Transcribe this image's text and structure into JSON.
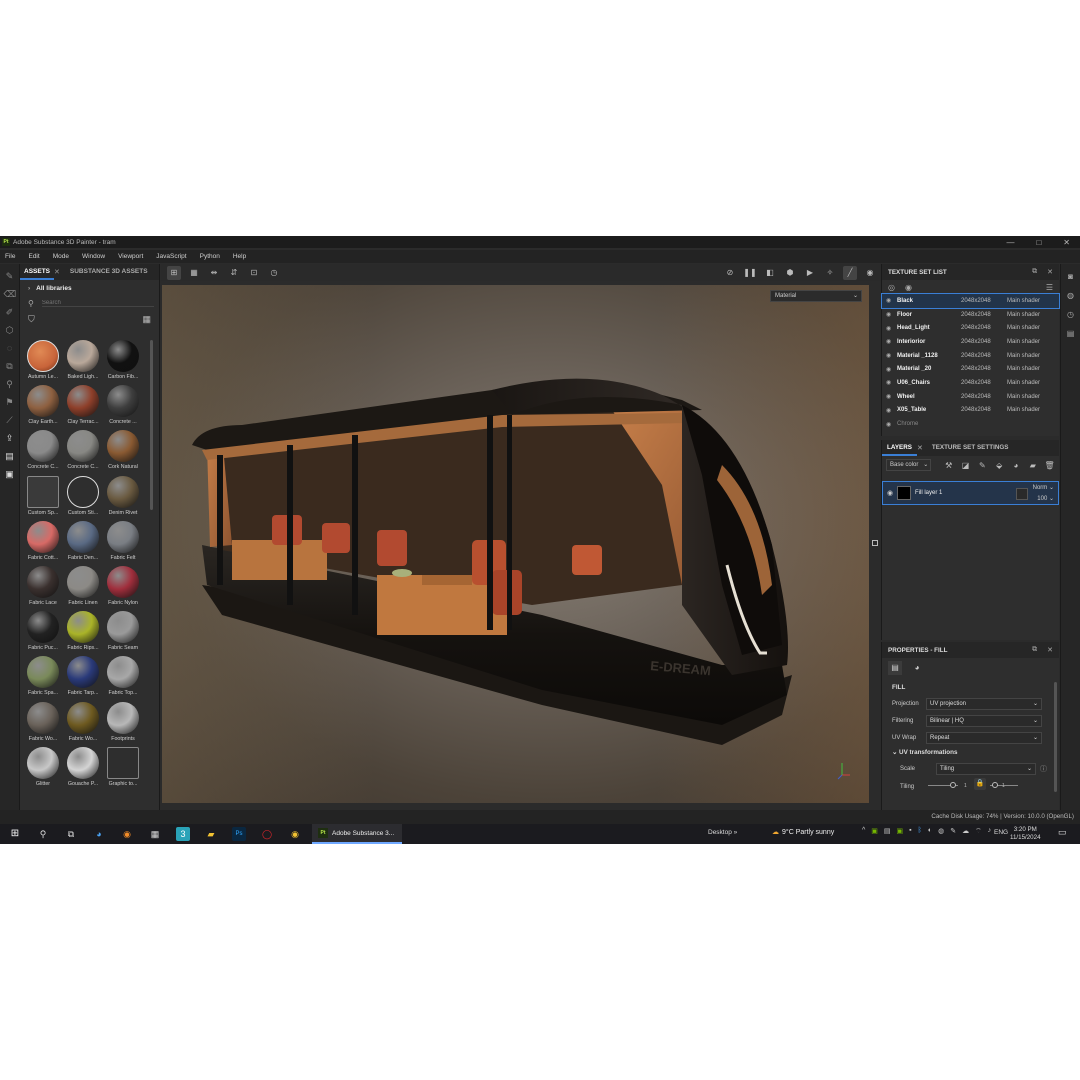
{
  "window": {
    "title": "Adobe Substance 3D Painter - tram",
    "logo": "Pt",
    "minimize": "—",
    "maximize": "□",
    "close": "✕"
  },
  "menu": [
    "File",
    "Edit",
    "Mode",
    "Window",
    "Viewport",
    "JavaScript",
    "Python",
    "Help"
  ],
  "assets_panel": {
    "tabs": [
      "ASSETS",
      "SUBSTANCE 3D ASSETS"
    ],
    "close": "✕",
    "library": "All libraries",
    "search_placeholder": "Search",
    "items": [
      {
        "label": "Autumn Le...",
        "color": "#c8643a",
        "shape": "leaf"
      },
      {
        "label": "Baked Ligh...",
        "color": "#b9a89a",
        "shape": "sphere"
      },
      {
        "label": "Carbon Fib...",
        "color": "#111111",
        "shape": "sphere"
      },
      {
        "label": "Clay Earth...",
        "color": "#8e6040",
        "shape": "sphere"
      },
      {
        "label": "Clay Terrac...",
        "color": "#8e3f2a",
        "shape": "sphere"
      },
      {
        "label": "Concrete ...",
        "color": "#3e3e3e",
        "shape": "sphere"
      },
      {
        "label": "Concrete C...",
        "color": "#8a8a8a",
        "shape": "sphere"
      },
      {
        "label": "Concrete C...",
        "color": "#888884",
        "shape": "sphere"
      },
      {
        "label": "Cork Natural",
        "color": "#8a5a32",
        "shape": "sphere"
      },
      {
        "label": "Custom Sp...",
        "color": "#3a3a3a",
        "shape": "square"
      },
      {
        "label": "Custom Sti...",
        "color": "#2e2e2e",
        "shape": "face"
      },
      {
        "label": "Denim Rivet",
        "color": "#6a5a40",
        "shape": "sphere"
      },
      {
        "label": "Fabric Cott...",
        "color": "#d86a66",
        "shape": "sphere"
      },
      {
        "label": "Fabric Den...",
        "color": "#5a6a84",
        "shape": "sphere"
      },
      {
        "label": "Fabric Felt",
        "color": "#7a7e84",
        "shape": "sphere"
      },
      {
        "label": "Fabric Lace",
        "color": "#3a302e",
        "shape": "sphere"
      },
      {
        "label": "Fabric Linen",
        "color": "#8c8a86",
        "shape": "sphere"
      },
      {
        "label": "Fabric Nylon",
        "color": "#a02e3c",
        "shape": "sphere"
      },
      {
        "label": "Fabric Puc...",
        "color": "#222222",
        "shape": "sphere"
      },
      {
        "label": "Fabric Rips...",
        "color": "#aab428",
        "shape": "sphere"
      },
      {
        "label": "Fabric Seam",
        "color": "#9a9a9a",
        "shape": "sphere"
      },
      {
        "label": "Fabric Spa...",
        "color": "#7a8a5a",
        "shape": "sphere"
      },
      {
        "label": "Fabric Tarp...",
        "color": "#2a3a7a",
        "shape": "sphere"
      },
      {
        "label": "Fabric Top...",
        "color": "#a8a8a8",
        "shape": "sphere"
      },
      {
        "label": "Fabric Wo...",
        "color": "#6a625a",
        "shape": "sphere"
      },
      {
        "label": "Fabric Wo...",
        "color": "#6e5a20",
        "shape": "sphere"
      },
      {
        "label": "Footprints",
        "color": "#b8b8b8",
        "shape": "sphere"
      },
      {
        "label": "Glitter",
        "color": "#c8c8c8",
        "shape": "sphere"
      },
      {
        "label": "Gouache P...",
        "color": "#d4d4d4",
        "shape": "sphere"
      },
      {
        "label": "Graphic to...",
        "color": "#2e2e2e",
        "shape": "square"
      }
    ]
  },
  "viewport": {
    "material_mode": "Material",
    "vehicle_text": "E-DREAM"
  },
  "texture_set_list": {
    "title": "TEXTURE SET LIST",
    "rows": [
      {
        "name": "Black",
        "size": "2048x2048",
        "shader": "Main shader"
      },
      {
        "name": "Floor",
        "size": "2048x2048",
        "shader": "Main shader"
      },
      {
        "name": "Head_Light",
        "size": "2048x2048",
        "shader": "Main shader"
      },
      {
        "name": "Interiorior",
        "size": "2048x2048",
        "shader": "Main shader"
      },
      {
        "name": "Material _1128",
        "size": "2048x2048",
        "shader": "Main shader"
      },
      {
        "name": "Material _20",
        "size": "2048x2048",
        "shader": "Main shader"
      },
      {
        "name": "U06_Chairs",
        "size": "2048x2048",
        "shader": "Main shader"
      },
      {
        "name": "Wheel",
        "size": "2048x2048",
        "shader": "Main shader"
      },
      {
        "name": "X05_Table",
        "size": "2048x2048",
        "shader": "Main shader"
      },
      {
        "name": "Chrome",
        "size": "",
        "shader": ""
      }
    ]
  },
  "layers": {
    "tabs": [
      "LAYERS",
      "TEXTURE SET SETTINGS"
    ],
    "channel": "Base color",
    "layer_name": "Fill layer 1",
    "blend": "Norm",
    "opacity": "100"
  },
  "properties": {
    "title": "PROPERTIES - FILL",
    "section": "FILL",
    "projection_label": "Projection",
    "projection_value": "UV projection",
    "filtering_label": "Filtering",
    "filtering_value": "Bilinear | HQ",
    "uvwrap_label": "UV Wrap",
    "uvwrap_value": "Repeat",
    "uv_section": "UV transformations",
    "scale_label": "Scale",
    "scale_value": "Tiling",
    "tiling_label": "Tiling",
    "tiling_a": "1",
    "tiling_b": "1"
  },
  "status": {
    "text": "Cache Disk Usage:  74% | Version: 10.0.0 (OpenGL)"
  },
  "taskbar": {
    "app_label": "Adobe Substance 3...",
    "app_logo": "Pt",
    "desktop": "Desktop",
    "weather": "9°C  Partly sunny",
    "language": "ENG",
    "time": "3:20 PM",
    "date": "11/15/2024"
  }
}
